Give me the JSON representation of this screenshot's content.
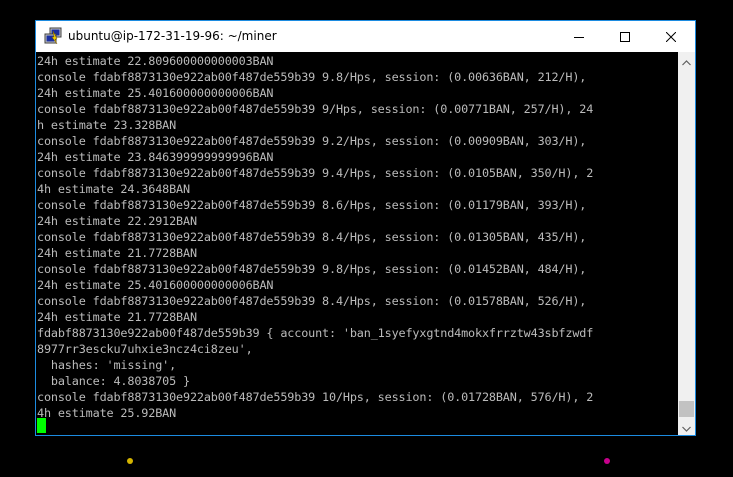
{
  "window": {
    "title": "ubuntu@ip-172-31-19-96: ~/miner",
    "icon": "putty-icon",
    "controls": {
      "minimize_icon": "minimize-icon",
      "maximize_icon": "maximize-icon",
      "close_icon": "close-icon"
    }
  },
  "terminal": {
    "text_color": "#bbbbbb",
    "background": "#000000",
    "cursor_color": "#00ff00",
    "lines": [
      "24h estimate 22.809600000000003BAN",
      "console fdabf8873130e922ab00f487de559b39 9.8/Hps, session: (0.00636BAN, 212/H),",
      "24h estimate 25.401600000000006BAN",
      "console fdabf8873130e922ab00f487de559b39 9/Hps, session: (0.00771BAN, 257/H), 24",
      "h estimate 23.328BAN",
      "console fdabf8873130e922ab00f487de559b39 9.2/Hps, session: (0.00909BAN, 303/H),",
      "24h estimate 23.846399999999996BAN",
      "console fdabf8873130e922ab00f487de559b39 9.4/Hps, session: (0.0105BAN, 350/H), 2",
      "4h estimate 24.3648BAN",
      "console fdabf8873130e922ab00f487de559b39 8.6/Hps, session: (0.01179BAN, 393/H),",
      "24h estimate 22.2912BAN",
      "console fdabf8873130e922ab00f487de559b39 8.4/Hps, session: (0.01305BAN, 435/H),",
      "24h estimate 21.7728BAN",
      "console fdabf8873130e922ab00f487de559b39 9.8/Hps, session: (0.01452BAN, 484/H),",
      "24h estimate 25.401600000000006BAN",
      "console fdabf8873130e922ab00f487de559b39 8.4/Hps, session: (0.01578BAN, 526/H),",
      "24h estimate 21.7728BAN",
      "fdabf8873130e922ab00f487de559b39 { account: 'ban_1syefyxgtnd4mokxfrrztw43sbfzwdf",
      "8977rr3escku7uhxie3ncz4ci8zeu',",
      "  hashes: 'missing',",
      "  balance: 4.8038705 }",
      "console fdabf8873130e922ab00f487de559b39 10/Hps, session: (0.01728BAN, 576/H), 2",
      "4h estimate 25.92BAN"
    ]
  },
  "scrollbar": {
    "up_icon": "scroll-up-arrow-icon",
    "down_icon": "scroll-down-arrow-icon",
    "position": 1.0
  },
  "background_dots": {
    "left_color": "#d4b400",
    "right_color": "#c8008c"
  }
}
